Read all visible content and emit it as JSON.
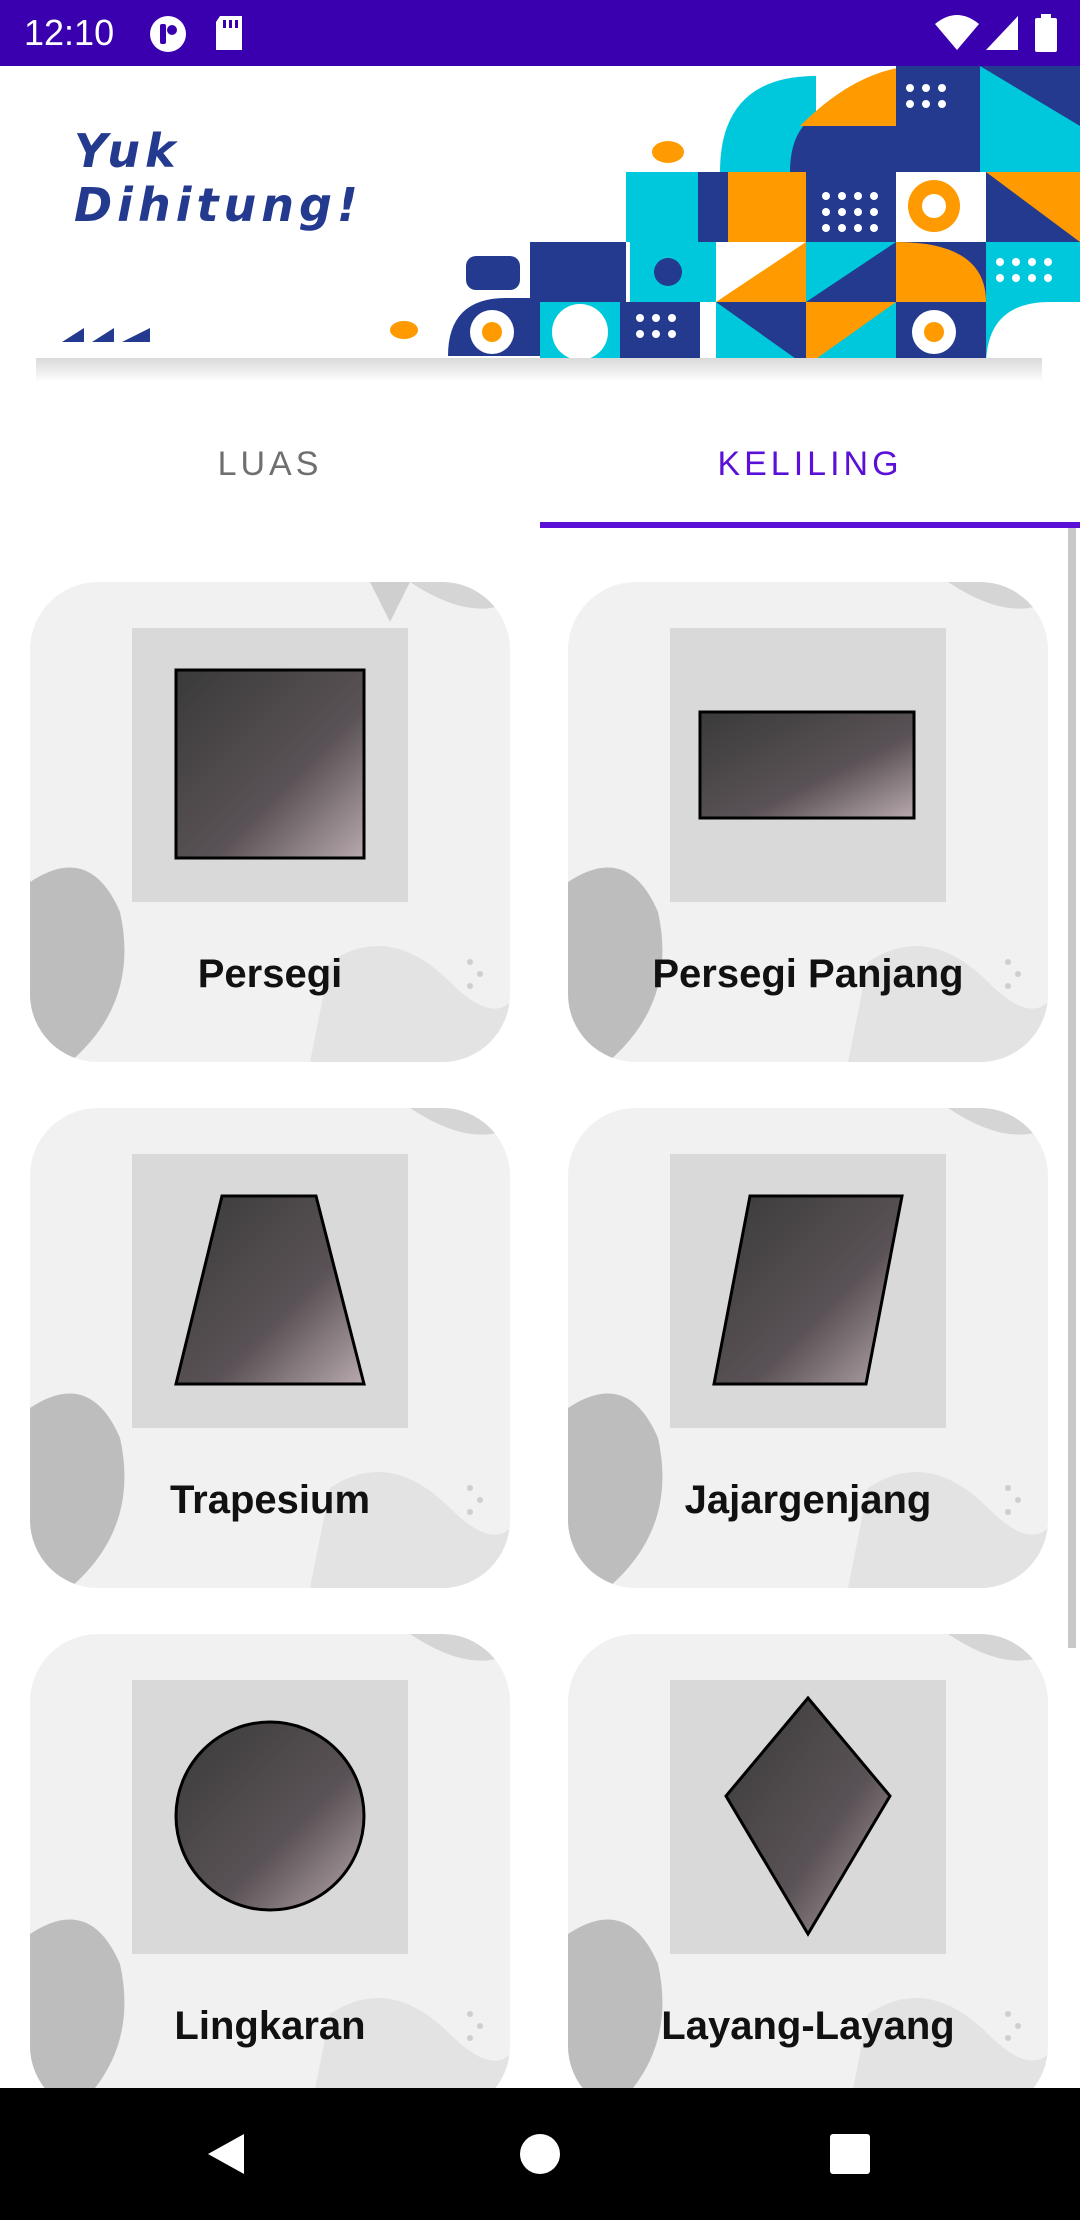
{
  "status_bar": {
    "time": "12:10",
    "icons": [
      "notification-app-icon",
      "sd-card-icon",
      "wifi-icon",
      "signal-icon",
      "battery-icon"
    ]
  },
  "banner": {
    "title_line1": "Yuk",
    "title_line2": "Dihitung!"
  },
  "tabs": [
    {
      "label": "LUAS",
      "selected": false
    },
    {
      "label": "KELILING",
      "selected": true
    }
  ],
  "shapes": [
    {
      "label": "Persegi",
      "icon": "square-icon"
    },
    {
      "label": "Persegi Panjang",
      "icon": "rectangle-icon"
    },
    {
      "label": "Trapesium",
      "icon": "trapezoid-icon"
    },
    {
      "label": "Jajargenjang",
      "icon": "parallelogram-icon"
    },
    {
      "label": "Lingkaran",
      "icon": "circle-icon"
    },
    {
      "label": "Layang-Layang",
      "icon": "kite-icon"
    }
  ],
  "colors": {
    "status_bar": "#3a00b0",
    "accent": "#5a10d6",
    "banner_navy": "#243a8f",
    "banner_cyan": "#00c8dc",
    "banner_orange": "#ff9a00"
  },
  "nav_bar": {
    "buttons": [
      "back-icon",
      "home-icon",
      "recents-icon"
    ]
  }
}
